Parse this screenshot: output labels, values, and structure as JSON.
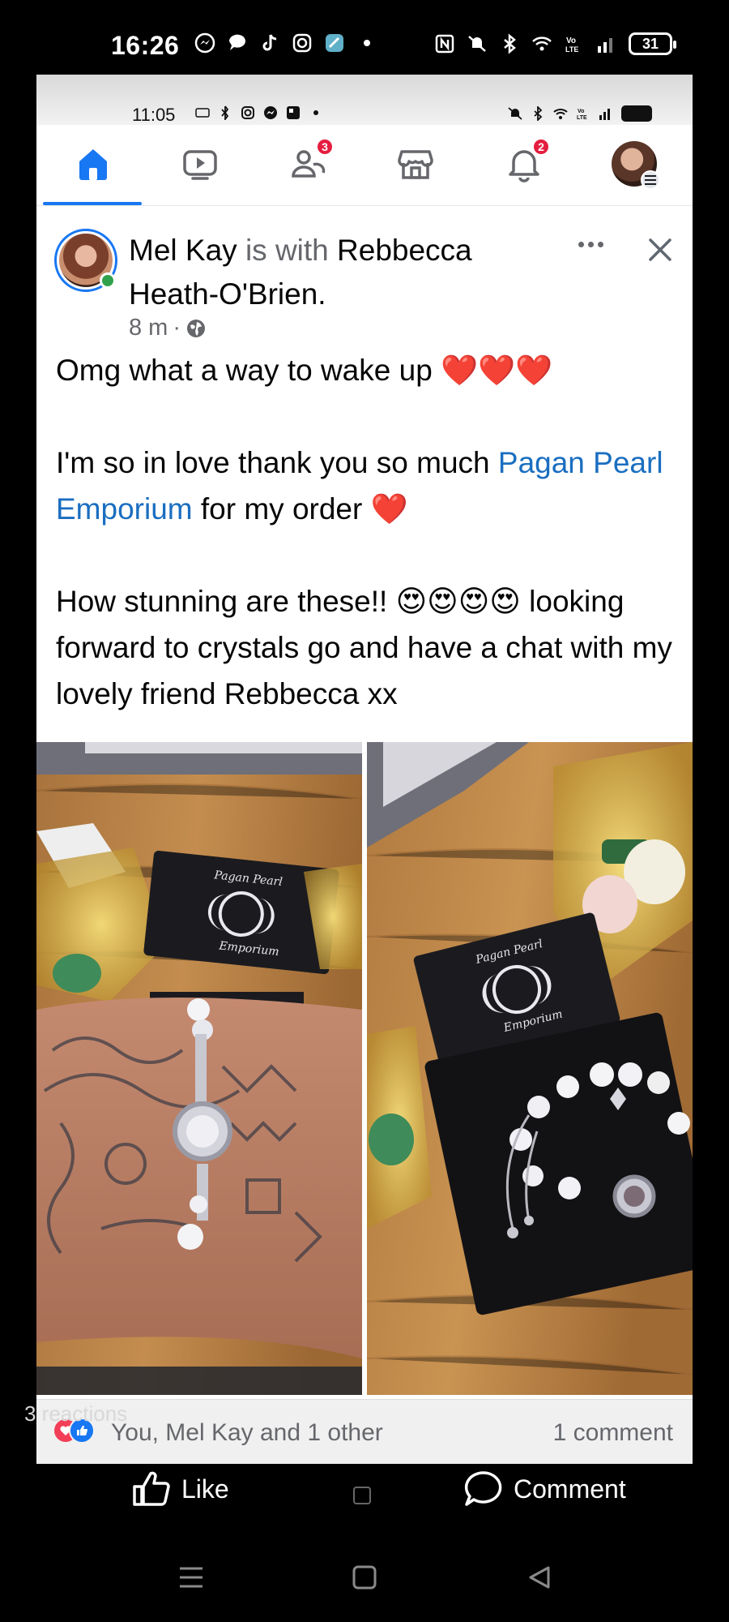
{
  "outer_status": {
    "time": "16:26",
    "battery": "31",
    "icons": [
      "messenger-icon",
      "chat-bubble-icon",
      "tiktok-icon",
      "instagram-icon",
      "app-icon",
      "nfc-icon",
      "mute-icon",
      "bluetooth-icon",
      "wifi-icon",
      "volte-icon",
      "signal-icon"
    ]
  },
  "inner_status": {
    "time": "11:05",
    "icons": [
      "alarm-icon",
      "bluetooth-icon",
      "instagram-icon",
      "messenger-icon",
      "app-icon",
      "mute-icon",
      "wifi-icon",
      "volte-icon",
      "signal-icon",
      "battery-icon"
    ]
  },
  "fb_nav": {
    "items": [
      {
        "name": "home",
        "active": true
      },
      {
        "name": "video"
      },
      {
        "name": "friends",
        "badge": "3"
      },
      {
        "name": "marketplace"
      },
      {
        "name": "notifications",
        "badge": "2"
      },
      {
        "name": "profile-menu"
      }
    ]
  },
  "post": {
    "author": "Mel Kay",
    "with_text": "is with",
    "tagged": "Rebbecca Heath-O'Brien",
    "time": "8 m",
    "separator": "·",
    "privacy_icon": "globe-icon",
    "paragraph1_text": "Omg what a way to wake up ",
    "paragraph1_emoji": "❤️❤️❤️",
    "paragraph2_before": "I'm so in love thank you so much ",
    "paragraph2_link": "Pagan Pearl Emporium",
    "paragraph2_after": " for my order ",
    "paragraph2_emoji": "❤️",
    "paragraph3_before": "How stunning are these!! ",
    "paragraph3_emoji": "😍😍😍😍",
    "paragraph3_after": " looking forward to crystals go and have a chat with my lovely friend Rebbecca xx",
    "card_brand_top": "Pagan Pearl",
    "card_brand_bottom": "Emporium"
  },
  "reactions": {
    "summary": "You, Mel Kay and 1 other",
    "comments": "1 comment",
    "overlay_label": "3 reactions"
  },
  "actions": {
    "like": "Like",
    "comment": "Comment"
  },
  "colors": {
    "facebook_blue": "#1877f2",
    "link_blue": "#1a6ec0",
    "badge_red": "#e41e3f",
    "online_green": "#31a24c"
  }
}
